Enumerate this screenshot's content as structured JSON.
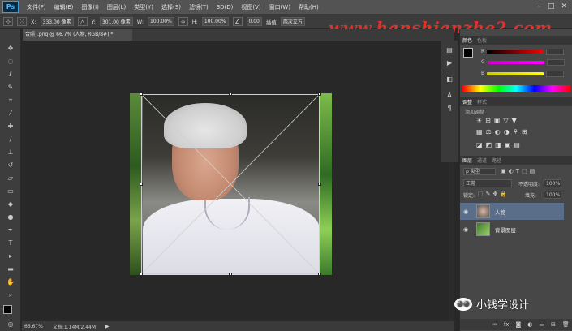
{
  "app": {
    "logo": "Ps"
  },
  "menu": [
    "文件(F)",
    "编辑(E)",
    "图像(I)",
    "图层(L)",
    "类型(Y)",
    "选择(S)",
    "滤镜(T)",
    "3D(D)",
    "视图(V)",
    "窗口(W)",
    "帮助(H)"
  ],
  "options": {
    "x_label": "X:",
    "x_value": "333.00 像素",
    "y_label": "Y:",
    "y_value": "301.00 像素",
    "w_label": "W:",
    "w_value": "100.00%",
    "h_label": "H:",
    "h_value": "100.00%",
    "angle_value": "0.00",
    "interp_label": "插值",
    "warp_label": "两次立方"
  },
  "watermark": "www.hanshianzhe2.com",
  "document": {
    "tab_title": "合照_.png @ 66.7% (人物, RGB/8#) *",
    "zoom": "66.67%",
    "doc_size": "文档:1.14M/2.44M"
  },
  "panels": {
    "color_tabs": [
      "颜色",
      "色板"
    ],
    "color_labels": [
      "R",
      "G",
      "B"
    ],
    "adjust_tabs": [
      "调整",
      "样式"
    ],
    "adjust_hint": "添加调整",
    "layers_tabs": [
      "图层",
      "通道",
      "路径"
    ],
    "kind_label": "ρ 类型",
    "blend_mode": "正常",
    "opacity_label": "不透明度:",
    "opacity_value": "100%",
    "lock_label": "锁定:",
    "fill_label": "填充:",
    "fill_value": "100%",
    "layers": [
      {
        "name": "人物"
      },
      {
        "name": "背景图层"
      }
    ]
  },
  "brand_watermark": "小钱学设计",
  "colors": {
    "accent": "#2fa3e6",
    "watermark_red": "#e0322a",
    "selected_layer": "#5a6e8a"
  }
}
